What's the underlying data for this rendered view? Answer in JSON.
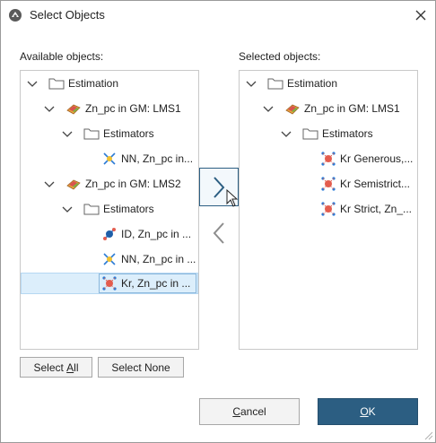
{
  "window": {
    "title": "Select Objects"
  },
  "available": {
    "label": "Available objects:",
    "tree": [
      {
        "text": "Estimation",
        "kind": "folder"
      },
      {
        "text": "Zn_pc in GM: LMS1",
        "kind": "gm-model"
      },
      {
        "text": "Estimators",
        "kind": "folder"
      },
      {
        "text": "NN, Zn_pc in...",
        "kind": "nn-estimator"
      },
      {
        "text": "Zn_pc in GM: LMS2",
        "kind": "gm-model"
      },
      {
        "text": "Estimators",
        "kind": "folder"
      },
      {
        "text": "ID, Zn_pc in ...",
        "kind": "id-estimator"
      },
      {
        "text": "NN, Zn_pc in ...",
        "kind": "nn-estimator"
      },
      {
        "text": "Kr, Zn_pc in ...",
        "kind": "kriging-estimator"
      }
    ]
  },
  "selected": {
    "label": "Selected objects:",
    "tree": [
      {
        "text": "Estimation",
        "kind": "folder"
      },
      {
        "text": "Zn_pc in GM: LMS1",
        "kind": "gm-model"
      },
      {
        "text": "Estimators",
        "kind": "folder"
      },
      {
        "text": "Kr Generous,...",
        "kind": "kriging-estimator"
      },
      {
        "text": "Kr Semistrict...",
        "kind": "kriging-estimator"
      },
      {
        "text": "Kr Strict, Zn_...",
        "kind": "kriging-estimator"
      }
    ]
  },
  "buttons": {
    "select_all_prefix": "Select ",
    "select_all_mnemonic": "A",
    "select_all_suffix": "ll",
    "select_none": "Select None",
    "cancel_mnemonic": "C",
    "cancel_rest": "ancel",
    "ok_mnemonic": "O",
    "ok_rest": "K"
  },
  "colors": {
    "ok_bg": "#2c5e82",
    "selection_bg": "#dceefb",
    "move_arrow": "#2c5e82"
  }
}
